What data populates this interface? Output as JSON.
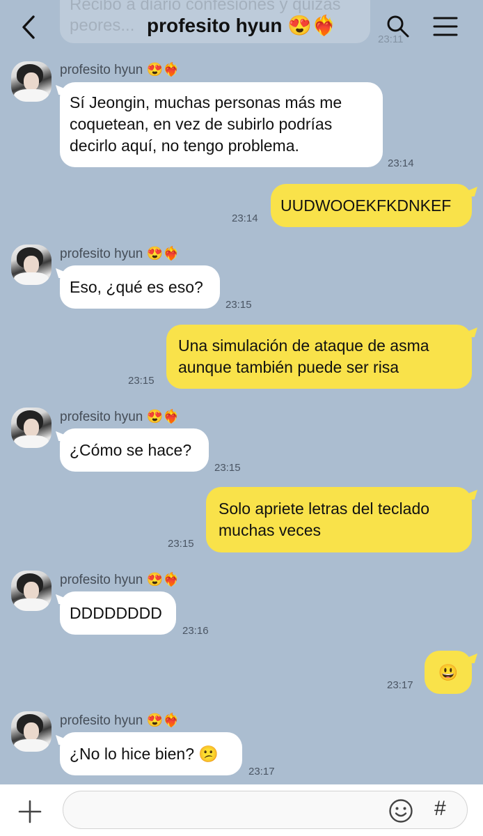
{
  "header": {
    "title": "profesito hyun",
    "title_emoji": "😍❤️‍🔥",
    "prev_message_partial": "Recibo a diario confesiones y quizás peores...",
    "prev_time": "23:11"
  },
  "contact": {
    "name": "profesito hyun",
    "name_emoji": "😍❤️‍🔥"
  },
  "messages": [
    {
      "dir": "in",
      "text": "Sí Jeongin, muchas personas más me coquetean, en vez de subirlo podrías decirlo aquí, no tengo problema.",
      "time": "23:14"
    },
    {
      "dir": "out",
      "text": "UUDWOOEKFKDNKEF",
      "time": "23:14"
    },
    {
      "dir": "in",
      "text": "Eso, ¿qué es eso?",
      "time": "23:15"
    },
    {
      "dir": "out",
      "text": "Una simulación de ataque de asma aunque también puede ser risa",
      "time": "23:15"
    },
    {
      "dir": "in",
      "text": "¿Cómo se hace?",
      "time": "23:15"
    },
    {
      "dir": "out",
      "text": "Solo apriete letras del teclado muchas veces",
      "time": "23:15"
    },
    {
      "dir": "in",
      "text": "DDDDDDDD",
      "time": "23:16"
    },
    {
      "dir": "out",
      "text": "😃",
      "time": "23:17"
    },
    {
      "dir": "in",
      "text": "¿No lo hice bien? 😕",
      "time": "23:17"
    }
  ],
  "input": {
    "placeholder": "",
    "hash_label": "#"
  },
  "colors": {
    "background": "#abbdd0",
    "outgoing_bubble": "#f9e24a",
    "incoming_bubble": "#ffffff"
  },
  "icons": [
    "back-arrow-icon",
    "search-icon",
    "menu-icon",
    "plus-icon",
    "emoji-icon",
    "hashtag-icon"
  ]
}
